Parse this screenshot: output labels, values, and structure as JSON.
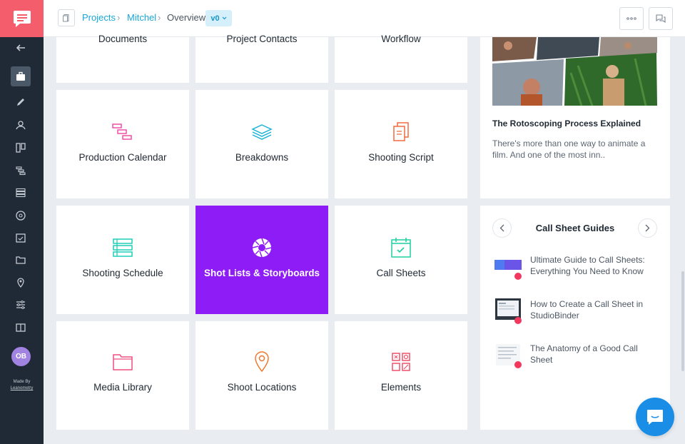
{
  "sidebar": {
    "avatar_initials": "OB",
    "made_by": "Made By",
    "made_by_brand": "Leanometry"
  },
  "breadcrumb": {
    "projects": "Projects",
    "project": "Mitchel",
    "current": "Overview",
    "version": "v0"
  },
  "top_tiles": {
    "documents": "Documents",
    "project_contacts": "Project Contacts",
    "workflow": "Workflow"
  },
  "tiles": {
    "production_calendar": "Production Calendar",
    "breakdowns": "Breakdowns",
    "shooting_script": "Shooting Script",
    "shooting_schedule": "Shooting Schedule",
    "shot_lists": "Shot Lists & Storyboards",
    "call_sheets": "Call Sheets",
    "media_library": "Media Library",
    "shoot_locations": "Shoot Locations",
    "elements": "Elements"
  },
  "article": {
    "title": "The Rotoscoping Process Explained",
    "description": "There's more than one way to animate a film. And one of the most inn.."
  },
  "guides": {
    "title": "Call Sheet Guides",
    "items": [
      "Ultimate Guide to Call Sheets: Everything You Need to Know",
      "How to Create a Call Sheet in StudioBinder",
      "The Anatomy of a Good Call Sheet"
    ]
  },
  "colors": {
    "brand": "#f45d6b",
    "active_tile": "#8d1cf6",
    "link": "#1aa7d6",
    "chat": "#1a8ee6"
  }
}
